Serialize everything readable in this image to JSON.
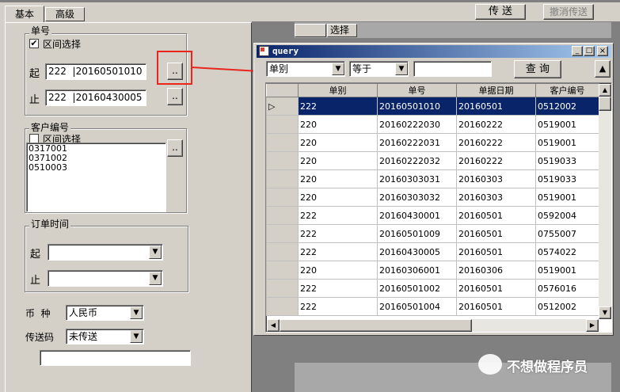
{
  "tabs": [
    {
      "label": "基本"
    },
    {
      "label": "高级"
    }
  ],
  "toolbar": {
    "send_label": "传 送",
    "cancel_send_label": "撤消传送",
    "select_label": "选择"
  },
  "order_no": {
    "group_title": "单号",
    "range_label": "区间选择",
    "range_checked": "✔",
    "from_label": "起",
    "from_type": "222",
    "from_value": "20160501010",
    "to_label": "止",
    "to_type": "222",
    "to_value": "20160430005",
    "browse_label": ".."
  },
  "customer": {
    "group_title": "客户编号",
    "range_label": "区间选择",
    "items": [
      "0317001",
      "0371002",
      "0510003"
    ],
    "browse_label": ".."
  },
  "order_time": {
    "group_title": "订单时间",
    "from_label": "起",
    "to_label": "止"
  },
  "currency": {
    "label": "币  种",
    "value": "人民币"
  },
  "send_code": {
    "label": "传送码",
    "value": "未传送"
  },
  "query_window": {
    "title": "query",
    "field_value": "单别",
    "op_value": "等于",
    "search_value": "",
    "query_button": "查 询",
    "columns": [
      "单别",
      "单号",
      "单据日期",
      "客户编号"
    ],
    "rows": [
      [
        "222",
        "20160501010",
        "20160501",
        "0512002"
      ],
      [
        "220",
        "20160222030",
        "20160222",
        "0519001"
      ],
      [
        "220",
        "20160222031",
        "20160222",
        "0519001"
      ],
      [
        "220",
        "20160222032",
        "20160222",
        "0519033"
      ],
      [
        "220",
        "20160303031",
        "20160303",
        "0519033"
      ],
      [
        "220",
        "20160303032",
        "20160303",
        "0519001"
      ],
      [
        "222",
        "20160430001",
        "20160501",
        "0592004"
      ],
      [
        "222",
        "20160501009",
        "20160501",
        "0755007"
      ],
      [
        "222",
        "20160430005",
        "20160501",
        "0574022"
      ],
      [
        "220",
        "20160306001",
        "20160306",
        "0519001"
      ],
      [
        "222",
        "20160501002",
        "20160501",
        "0576016"
      ],
      [
        "222",
        "20160501004",
        "20160501",
        "0512002"
      ]
    ]
  },
  "watermark": "不想做程序员",
  "colors": {
    "highlight": "#0a246a",
    "arrow": "#e8261d",
    "titlebar": "#0a246a"
  }
}
